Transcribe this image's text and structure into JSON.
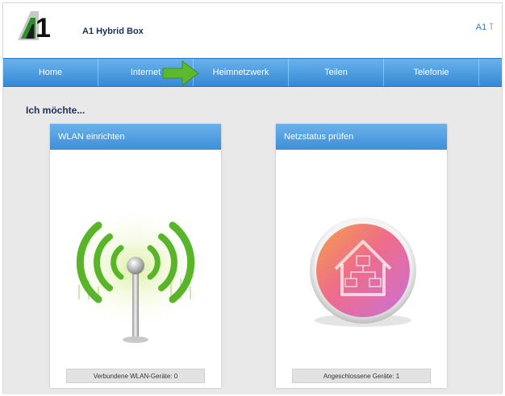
{
  "header": {
    "logo_text": "A1",
    "app_title": "A1 Hybrid Box",
    "user_label": "A1 ⊺"
  },
  "nav": {
    "items": [
      {
        "label": "Home"
      },
      {
        "label": "Internet"
      },
      {
        "label": "Heimnetzwerk"
      },
      {
        "label": "Teilen"
      },
      {
        "label": "Telefonie"
      }
    ]
  },
  "main": {
    "section_title": "Ich möchte...",
    "cards": [
      {
        "title": "WLAN einrichten",
        "status": "Verbundene WLAN-Geräte: 0",
        "icon": "wifi-icon"
      },
      {
        "title": "Netzstatus prüfen",
        "status": "Angeschlossene Geräte: 1",
        "icon": "home-network-icon"
      }
    ]
  },
  "colors": {
    "nav_blue": "#3b8fdc",
    "title_navy": "#1a2f56",
    "accent_green": "#5cb82e",
    "content_grey": "#e9e9e9"
  }
}
